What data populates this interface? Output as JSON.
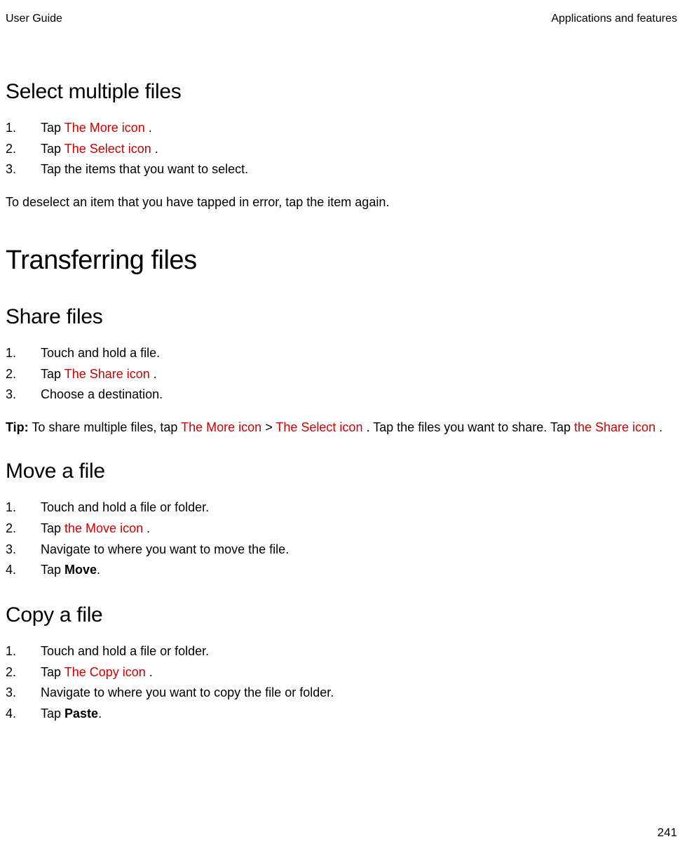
{
  "header": {
    "left": "User Guide",
    "right": "Applications and features"
  },
  "section1": {
    "title": "Select multiple files",
    "steps": {
      "s1_prefix": "Tap ",
      "s1_icon": "The More icon",
      "s1_suffix": " .",
      "s2_prefix": "Tap ",
      "s2_icon": "The Select icon",
      "s2_suffix": " .",
      "s3": "Tap the items that you want to select."
    },
    "note": "To deselect an item that you have tapped in error, tap the item again."
  },
  "section2": {
    "title": "Transferring files"
  },
  "section3": {
    "title": "Share files",
    "steps": {
      "s1": "Touch and hold a file.",
      "s2_prefix": "Tap ",
      "s2_icon": "The Share icon",
      "s2_suffix": " .",
      "s3": "Choose a destination."
    },
    "tip": {
      "label": "Tip:",
      "t1": " To share multiple files, tap ",
      "icon1": "The More icon",
      "sep": "  > ",
      "icon2": "The Select icon",
      "t2": " . Tap the files you want to share. Tap ",
      "icon3": "the Share icon",
      "t3": " ."
    }
  },
  "section4": {
    "title": "Move a file",
    "steps": {
      "s1": "Touch and hold a file or folder.",
      "s2_prefix": "Tap ",
      "s2_icon": "the Move icon",
      "s2_suffix": " .",
      "s3": "Navigate to where you want to move the file.",
      "s4_prefix": "Tap ",
      "s4_bold": "Move",
      "s4_suffix": "."
    }
  },
  "section5": {
    "title": "Copy a file",
    "steps": {
      "s1": "Touch and hold a file or folder.",
      "s2_prefix": "Tap ",
      "s2_icon": "The Copy icon",
      "s2_suffix": " .",
      "s3": "Navigate to where you want to copy the file or folder.",
      "s4_prefix": "Tap ",
      "s4_bold": "Paste",
      "s4_suffix": "."
    }
  },
  "footer": {
    "page": "241"
  }
}
